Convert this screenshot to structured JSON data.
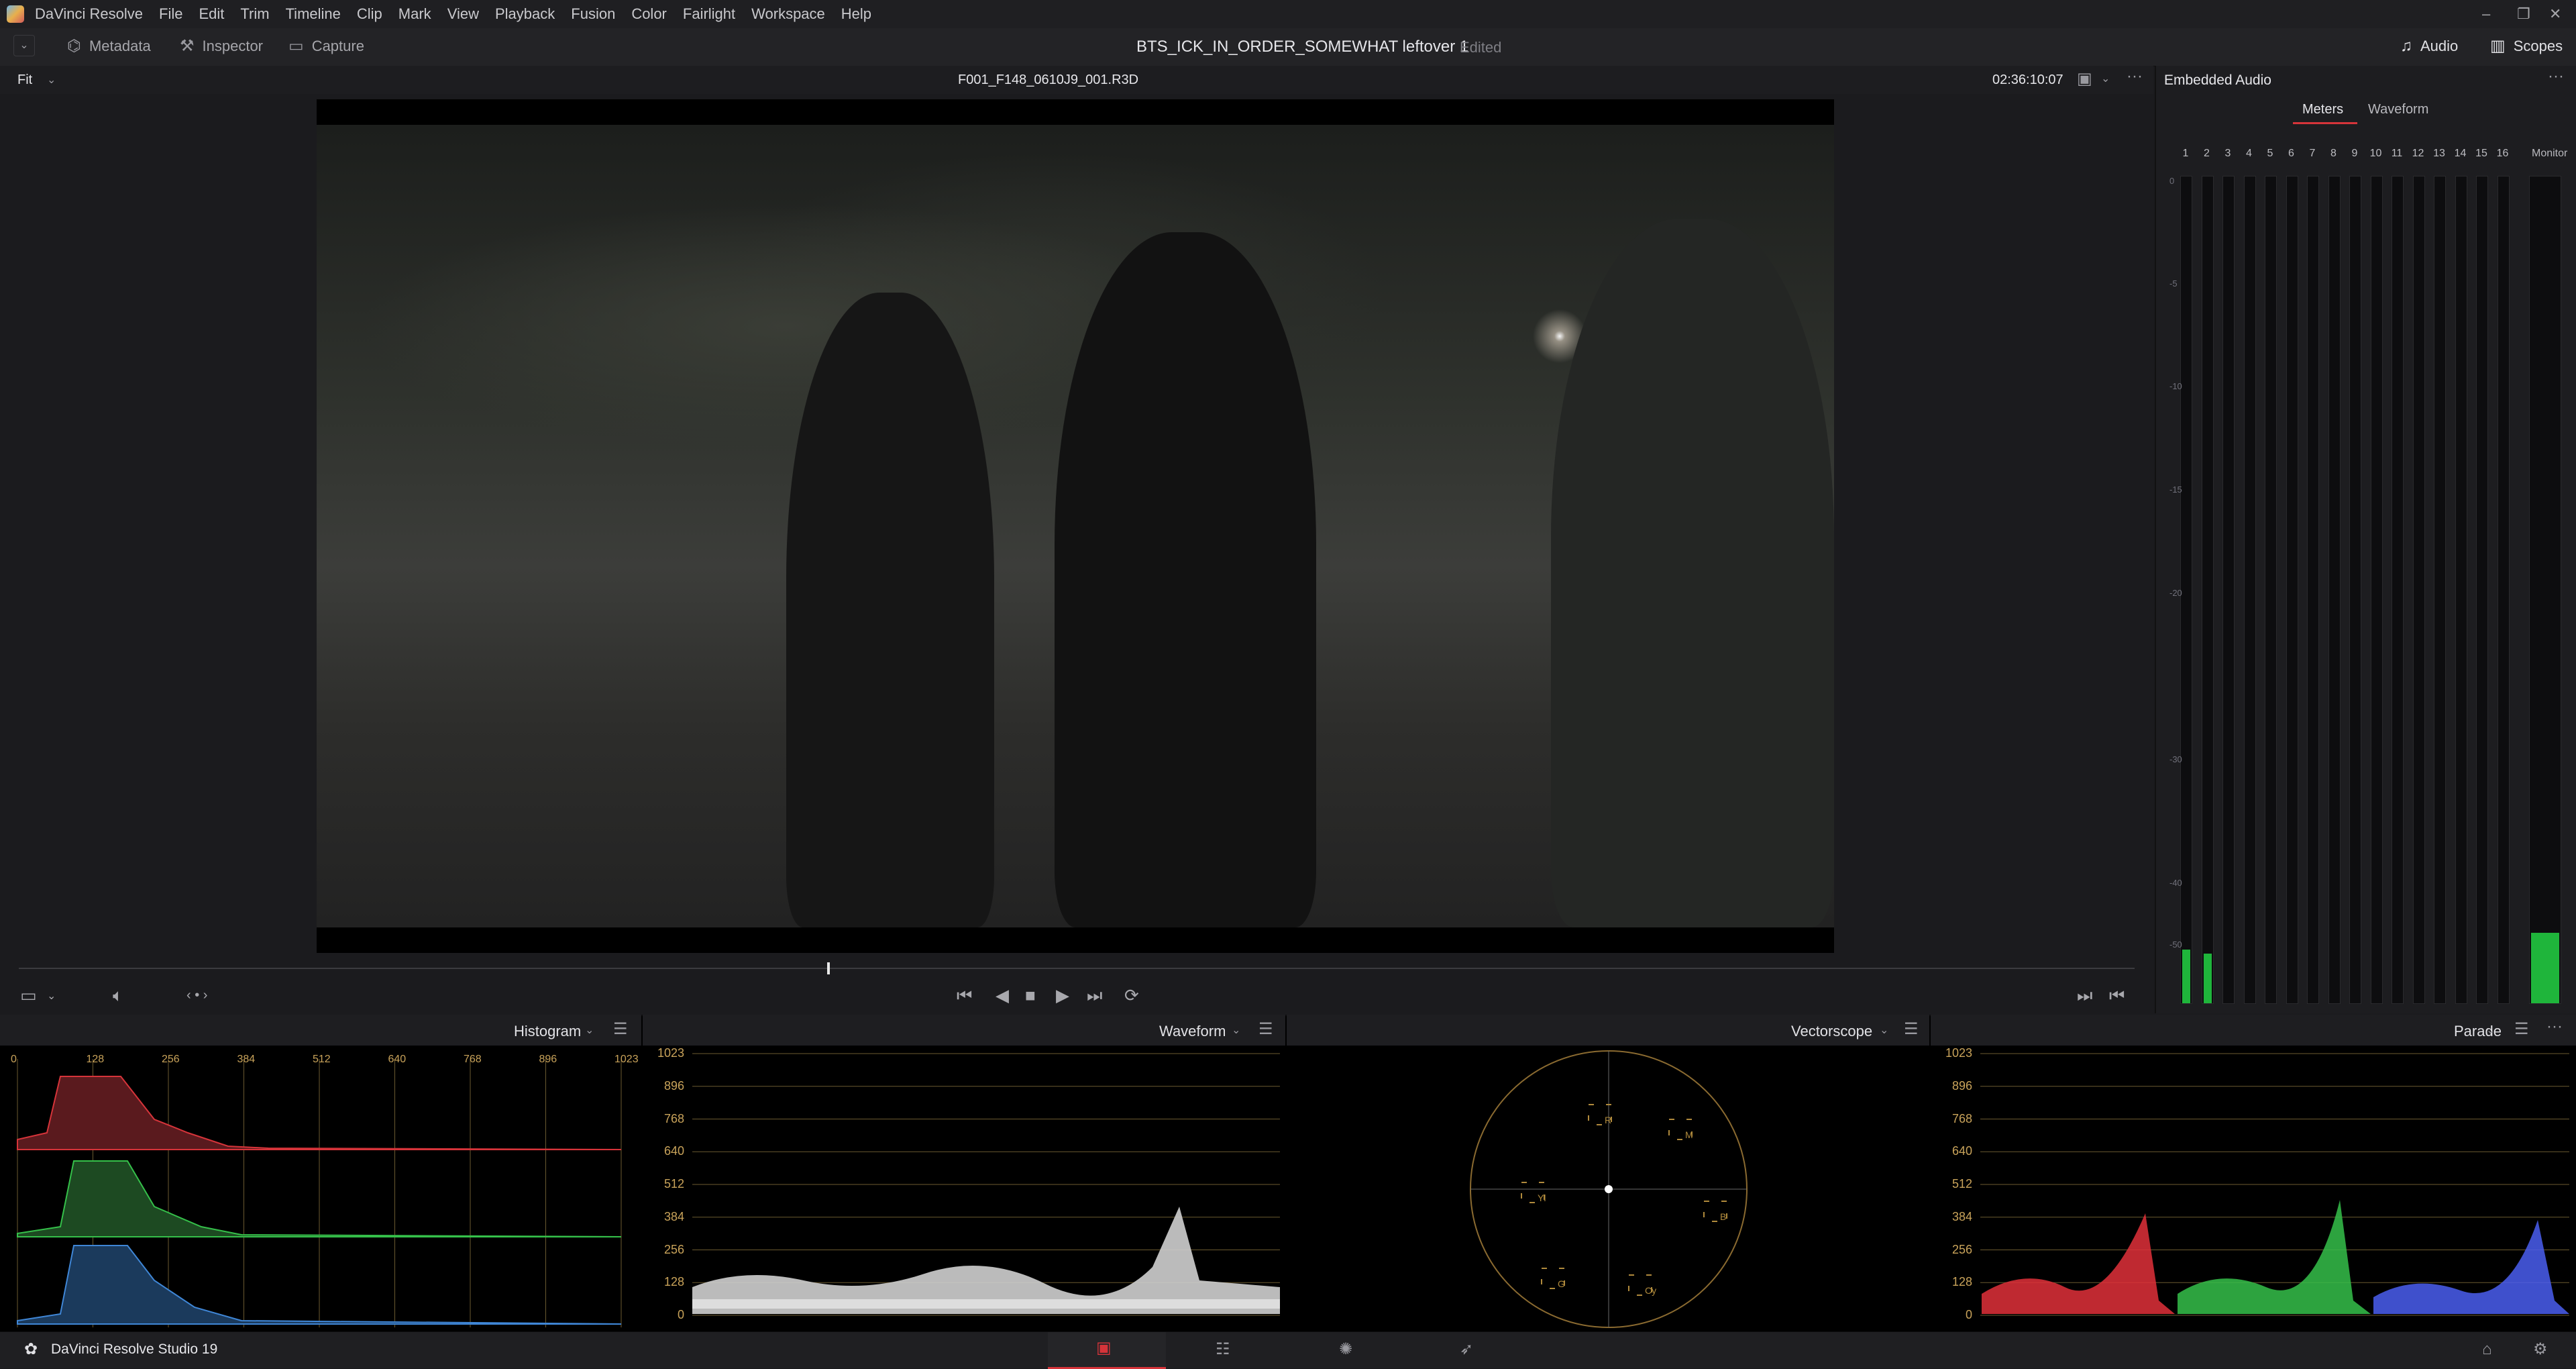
{
  "app": {
    "menu": [
      "DaVinci Resolve",
      "File",
      "Edit",
      "Trim",
      "Timeline",
      "Clip",
      "Mark",
      "View",
      "Playback",
      "Fusion",
      "Color",
      "Fairlight",
      "Workspace",
      "Help"
    ],
    "window_controls": [
      "–",
      "❐",
      "✕"
    ]
  },
  "toolbar": {
    "metadata": "Metadata",
    "inspector": "Inspector",
    "capture": "Capture",
    "project_title": "BTS_ICK_IN_ORDER_SOMEWHAT leftover 1",
    "project_status": "Edited",
    "audio": "Audio",
    "scopes": "Scopes"
  },
  "viewer": {
    "zoom": "Fit",
    "clip_name": "F001_F148_0610J9_001.R3D",
    "timecode": "02:36:10:07",
    "playhead_fraction": 0.382
  },
  "audio_panel": {
    "title": "Embedded Audio",
    "tabs": [
      "Meters",
      "Waveform"
    ],
    "active_tab": "Meters",
    "channels": [
      "1",
      "2",
      "3",
      "4",
      "5",
      "6",
      "7",
      "8",
      "9",
      "10",
      "11",
      "12",
      "13",
      "14",
      "15",
      "16"
    ],
    "monitor_label": "Monitor",
    "db_scale": [
      "0",
      "-5",
      "-10",
      "-15",
      "-20",
      "-30",
      "-40",
      "-50"
    ],
    "channel_levels": [
      0.065,
      0.06,
      0,
      0,
      0,
      0,
      0,
      0,
      0,
      0,
      0,
      0,
      0,
      0,
      0,
      0
    ],
    "monitor_level": 0.085
  },
  "scopes": {
    "histogram": {
      "label": "Histogram",
      "x_ticks": [
        "0",
        "128",
        "256",
        "384",
        "512",
        "640",
        "768",
        "896",
        "1023"
      ]
    },
    "waveform": {
      "label": "Waveform",
      "y_ticks": [
        "1023",
        "896",
        "768",
        "640",
        "512",
        "384",
        "256",
        "128",
        "0"
      ]
    },
    "vectorscope": {
      "label": "Vectorscope",
      "targets": [
        "R",
        "M",
        "B",
        "Cy",
        "G",
        "Yl"
      ]
    },
    "parade": {
      "label": "Parade",
      "y_ticks": [
        "1023",
        "896",
        "768",
        "640",
        "512",
        "384",
        "256",
        "128",
        "0"
      ]
    }
  },
  "statusbar": {
    "app_name": "DaVinci Resolve Studio 19"
  },
  "colors": {
    "accent_red": "#d6343a",
    "meter_green": "#1fb53b",
    "scope_grid": "#c9a35a"
  }
}
